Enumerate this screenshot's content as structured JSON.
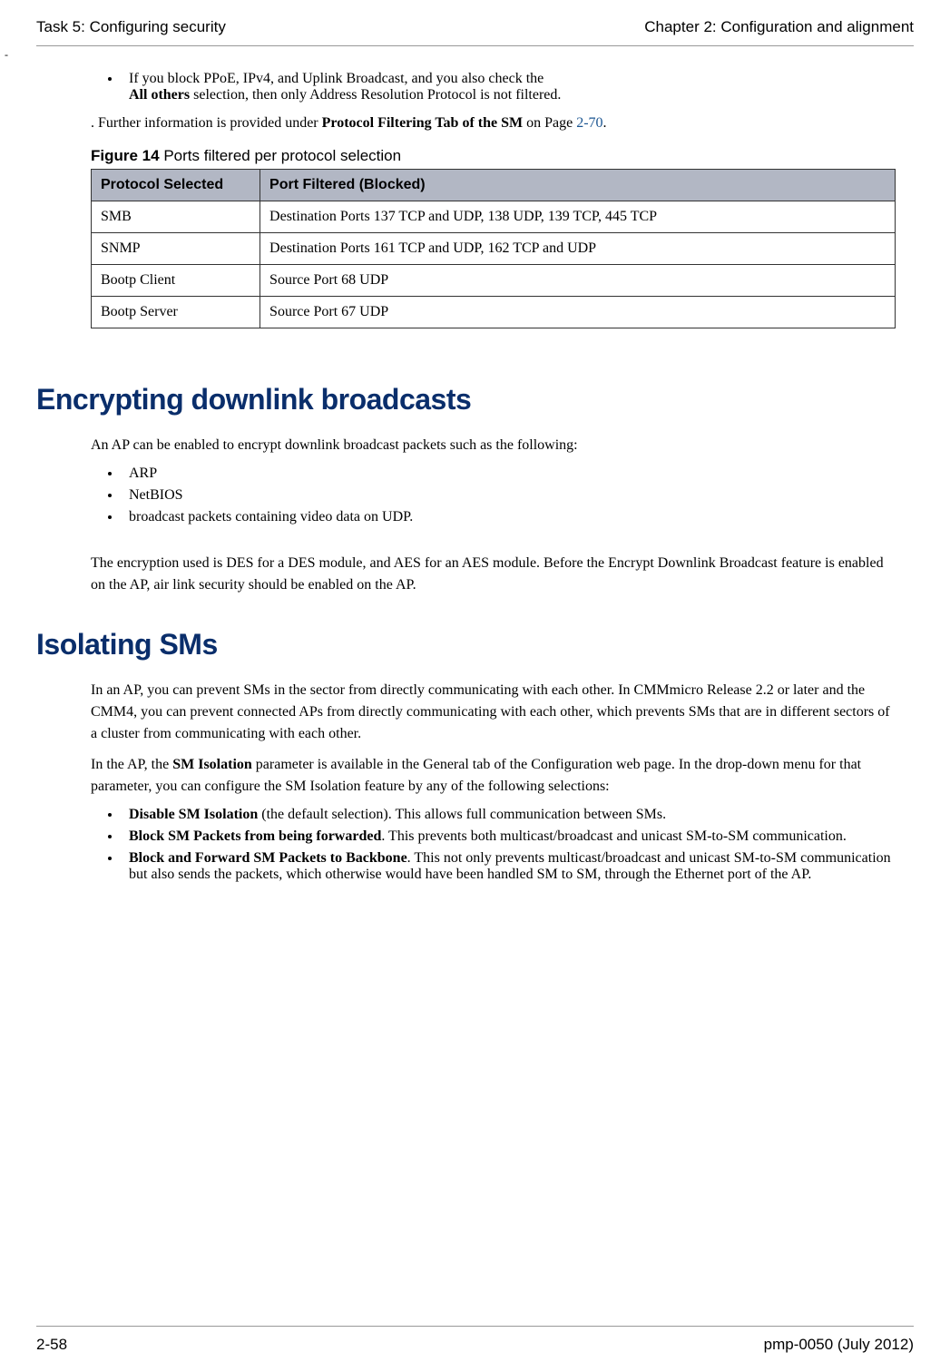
{
  "header": {
    "left": "Task 5: Configuring security",
    "right": "Chapter 2:  Configuration and alignment"
  },
  "dash": "-",
  "first_bullet": {
    "pre": "If you block PPoE, IPv4, and Uplink Broadcast, and you also check the ",
    "bold": "All others",
    "post": " selection, then only Address Resolution Protocol is not filtered."
  },
  "further_info": {
    "pre": ". Further information is provided under ",
    "bold": "Protocol Filtering Tab of the SM",
    "mid": " on Page ",
    "link": "2-70",
    "post": "."
  },
  "figure": {
    "label": "Figure 14",
    "caption": "  Ports filtered per protocol selection",
    "col1": "Protocol Selected",
    "col2": "Port Filtered (Blocked)",
    "rows": [
      {
        "p": "SMB",
        "f": "Destination Ports 137 TCP and UDP,  138 UDP, 139 TCP, 445 TCP"
      },
      {
        "p": "SNMP",
        "f": "Destination Ports 161 TCP and UDP, 162 TCP and UDP"
      },
      {
        "p": "Bootp Client",
        "f": "Source Port 68 UDP"
      },
      {
        "p": "Bootp Server",
        "f": "Source Port 67 UDP"
      }
    ]
  },
  "section1": {
    "heading": "Encrypting downlink broadcasts",
    "intro": "An AP can be enabled to encrypt downlink broadcast packets such as the following:",
    "items": [
      "ARP",
      "NetBIOS",
      "broadcast packets containing video data on UDP."
    ],
    "para": "The encryption used is DES for a DES module, and AES for an AES module. Before the Encrypt Downlink Broadcast feature is enabled on the AP, air link security should be enabled on the AP."
  },
  "section2": {
    "heading": "Isolating SMs",
    "para1": "In an AP, you can prevent SMs in the sector from directly communicating with each other. In CMMmicro Release 2.2 or later and the CMM4, you can prevent connected APs from directly communicating with each other, which prevents SMs that are in different sectors of a cluster from communicating with each other.",
    "para2_pre": "In the AP, the ",
    "para2_bold": "SM Isolation",
    "para2_post": " parameter is available in the General tab of the Configuration web page. In the drop-down menu for that parameter, you can configure the SM Isolation feature by any of the following selections:",
    "items": [
      {
        "bold": "Disable SM Isolation",
        "rest": " (the default selection). This allows full communication between SMs."
      },
      {
        "bold": "Block SM Packets from being forwarded",
        "rest": ". This prevents both multicast/broadcast and unicast SM-to-SM communication."
      },
      {
        "bold": "Block and Forward SM Packets to Backbone",
        "rest": ". This not only prevents multicast/broadcast and unicast SM-to-SM communication but also sends the packets, which otherwise would have been handled SM to SM, through the Ethernet port of the AP."
      }
    ]
  },
  "footer": {
    "left": "2-58",
    "right": "pmp-0050 (July 2012)"
  }
}
